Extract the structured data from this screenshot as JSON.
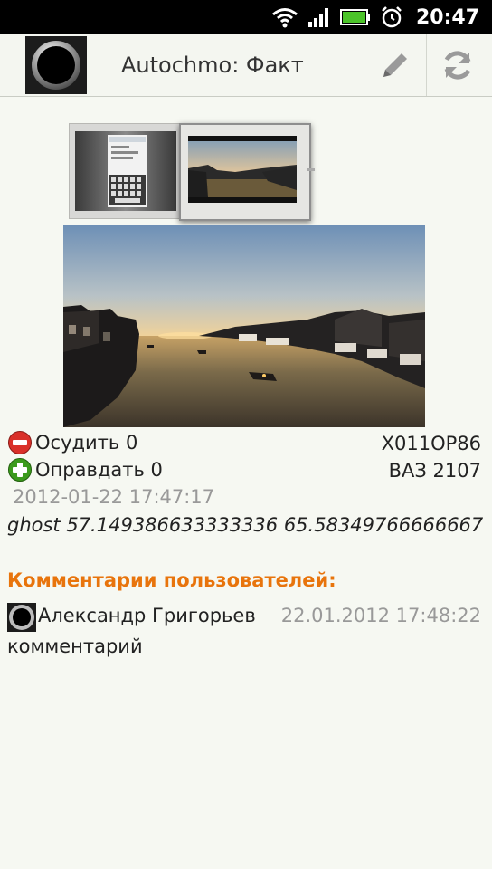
{
  "status_bar": {
    "time": "20:47"
  },
  "action_bar": {
    "title": "Autochmo: Факт",
    "icons": [
      "app-logo-icon",
      "edit-pencil-icon",
      "refresh-icon"
    ]
  },
  "fact": {
    "condemn_label": "Осудить 0",
    "justify_label": "Оправдать 0",
    "plate": "Х011ОР86",
    "car_model": "ВАЗ 2107",
    "datetime": "2012-01-22 17:47:17",
    "location": "ghost 57.149386633333336 65.58349766666667"
  },
  "comments": {
    "header": "Комментарии пользователей:",
    "items": [
      {
        "author": "Александр  Григорьев",
        "date": "22.01.2012 17:48:22",
        "text": "комментарий"
      }
    ]
  },
  "colors": {
    "accent": "#e8740c",
    "condemn": "#d9302a",
    "justify": "#3b9a1c"
  }
}
